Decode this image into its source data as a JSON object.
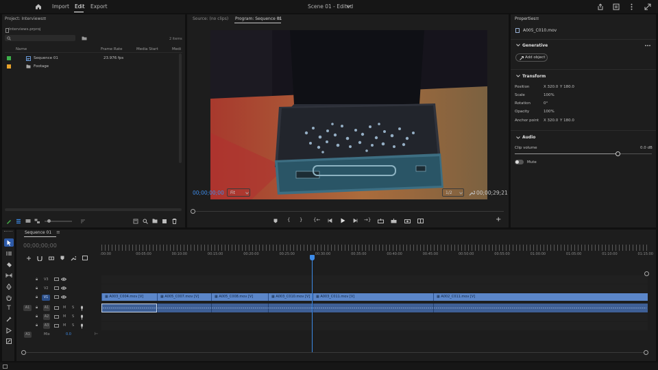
{
  "menu": {
    "import": "Import",
    "edit": "Edit",
    "export": "Export",
    "title": "Scene 01 - Edited"
  },
  "project": {
    "tab": "Project: Interviews",
    "file": "Interviews.prproj",
    "count": "2 items",
    "columns": [
      "Name",
      "Frame Rate",
      "Media Start",
      "Medi"
    ],
    "items": [
      {
        "name": "Sequence 01",
        "fps": "23.976 fps",
        "color": "#3db04b"
      },
      {
        "name": "Footage",
        "fps": "",
        "color": "#e8a32a"
      }
    ]
  },
  "monitor": {
    "source_tab": "Source: (no clips)",
    "program_tab": "Program: Sequence 01",
    "timecode_in": "00;00;00;00",
    "fit": "Fit",
    "resolution": "1/2",
    "timecode_out": "00;00;29;21"
  },
  "properties": {
    "tab": "Properties",
    "clip": "A005_C010.mov",
    "generative": "Generative",
    "add_object": "Add object",
    "transform": "Transform",
    "position_label": "Position",
    "position_x": "X 320.0",
    "position_y": "Y 180.0",
    "scale_label": "Scale",
    "scale": "100%",
    "rotation_label": "Rotation",
    "rotation": "0°",
    "opacity_label": "Opacity",
    "opacity": "100%",
    "anchor_label": "Anchor point",
    "anchor_x": "X 320.0",
    "anchor_y": "Y 180.0",
    "audio": "Audio",
    "clip_volume_label": "Clip volume",
    "clip_volume": "0.0 dB",
    "clip_volume_level": 0.75,
    "mute": "Mute"
  },
  "timeline": {
    "tab": "Sequence 01",
    "timecode": "00;00;00;00",
    "ruler": [
      ":00:00",
      "00:05:00",
      "00:10:00",
      "00:15:00",
      "00:20:00",
      "00:25:00",
      "00:30:00",
      "00:35:00",
      "00:40:00",
      "00:45:00",
      "00:50:00",
      "00:55:00",
      "01:00:00",
      "01:05:00",
      "01:10:00",
      "01:15:00"
    ],
    "tracks_video": [
      "V3",
      "V2",
      "V1"
    ],
    "tracks_audio": [
      "A1",
      "A2",
      "A3"
    ],
    "src_v": "V1",
    "src_a": "A1",
    "mix": "Mix",
    "mix_val": "0.0",
    "m": "M",
    "s": "S",
    "clips": [
      {
        "label": "A003_C004.mov [V]"
      },
      {
        "label": "A005_C007.mov [V]"
      },
      {
        "label": "A005_C008.mov [V]"
      },
      {
        "label": "A003_C010.mov [V]"
      },
      {
        "label": "A003_C011.mov [V]"
      },
      {
        "label": "A002_C011.mov [V]"
      }
    ]
  }
}
